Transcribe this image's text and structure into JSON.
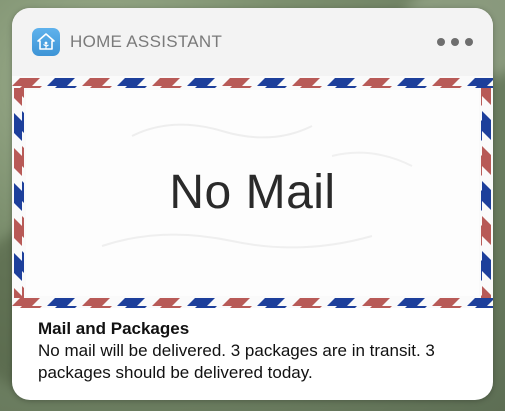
{
  "notification": {
    "app_name": "HOME ASSISTANT",
    "app_icon": "home-assistant-icon",
    "image_message": "No Mail",
    "title": "Mail and Packages",
    "body": "No mail will be delivered. 3 packages are in transit. 3 packages should be delivered today."
  },
  "colors": {
    "stripe_red": "#b85a57",
    "stripe_blue": "#1d3f9b",
    "app_icon_blue": "#4aa3e3"
  }
}
